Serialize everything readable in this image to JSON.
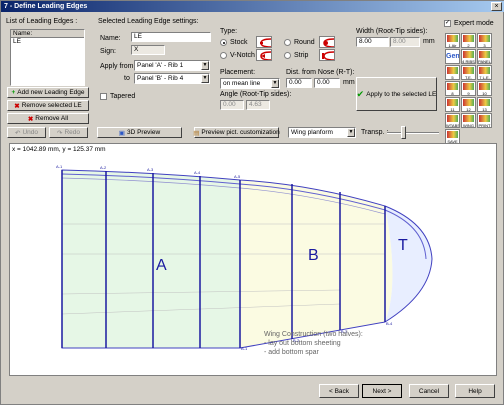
{
  "title": "7 - Define Leading Edges",
  "list": {
    "header": "List of Leading Edges :",
    "column": "Name:",
    "items": [
      "LE"
    ]
  },
  "buttons": {
    "add": "Add new Leading Edge",
    "remove_selected": "Remove selected LE",
    "remove_all": "Remove All",
    "undo": "Undo",
    "redo": "Redo",
    "preview3d": "3D Preview",
    "preview_pict": "Preview pict. customization",
    "apply": "Apply to the selected LE",
    "back": "< Back",
    "next": "Next >",
    "cancel": "Cancel",
    "help": "Help"
  },
  "settings": {
    "header": "Selected Leading Edge settings:",
    "name_label": "Name:",
    "name_value": "LE",
    "sign_label": "Sign:",
    "sign_value": "X",
    "apply_from_label": "Apply from",
    "apply_from_value": "Panel 'A' - Rib 1",
    "to_label": "to",
    "to_value": "Panel 'B' - Rib 4",
    "tapered_label": "Tapered"
  },
  "type": {
    "label": "Type:",
    "options": [
      "Stock",
      "Round",
      "V-Notch",
      "Strip"
    ],
    "selected": "Stock"
  },
  "width": {
    "label": "Width (Root-Tip sides):",
    "root": "8.00",
    "tip": "8.00",
    "unit": "mm"
  },
  "placement": {
    "label": "Placement:",
    "value": "on mean line",
    "dist_label": "Dist. from Nose (R-T):",
    "dist_root": "0.00",
    "dist_tip": "0.00",
    "dist_unit": "mm",
    "angle_label": "Angle (Root-Tip sides):",
    "angle_root": "0.00",
    "angle_tip": "4.63"
  },
  "expert_mode_label": "Expert mode",
  "view_select": "Wing planform",
  "transp_label": "Transp. :",
  "transparency": 0.3,
  "coords": "x = 1042.89 mm, y = 125.37 mm",
  "tools": [
    {
      "label": "1 Air",
      "kind": "plain"
    },
    {
      "label": "2 Wings",
      "kind": "plain"
    },
    {
      "label": "3 Wfoils",
      "kind": "plain"
    },
    {
      "label": "Gen",
      "kind": "gen"
    },
    {
      "label": "4 RIBS",
      "kind": "plain"
    },
    {
      "label": "PANEL EDITING",
      "kind": "plain"
    },
    {
      "label": "5 SHEET",
      "kind": "plain"
    },
    {
      "label": "T.E.",
      "kind": "plain"
    },
    {
      "label": "7 L.E.",
      "kind": "plain"
    },
    {
      "label": "8 SPAR",
      "kind": "plain"
    },
    {
      "label": "9 HOLE",
      "kind": "plain"
    },
    {
      "label": "10 DEG",
      "kind": "plain"
    },
    {
      "label": "11 RIBS",
      "kind": "plain"
    },
    {
      "label": "12 HOLE",
      "kind": "plain"
    },
    {
      "label": "13 MLD",
      "kind": "plain"
    },
    {
      "label": "WTABS",
      "kind": "plain"
    },
    {
      "label": "WING TIP",
      "kind": "plain"
    },
    {
      "label": "PRINT",
      "kind": "plain"
    },
    {
      "label": "SAVE",
      "kind": "plain"
    }
  ],
  "chart_data": {
    "type": "wing-planform",
    "panels": [
      "A",
      "B",
      "T"
    ],
    "rib_labels_top": [
      "A-1",
      "A-2",
      "A-3",
      "A-4",
      "A-5"
    ],
    "rib_labels_bottom": [
      "B-1",
      "B-2",
      "B-3",
      "B-4"
    ]
  },
  "notes": [
    "Wing Construction (two halves):",
    "- lay out bottom sheeting",
    "- add bottom spar"
  ]
}
